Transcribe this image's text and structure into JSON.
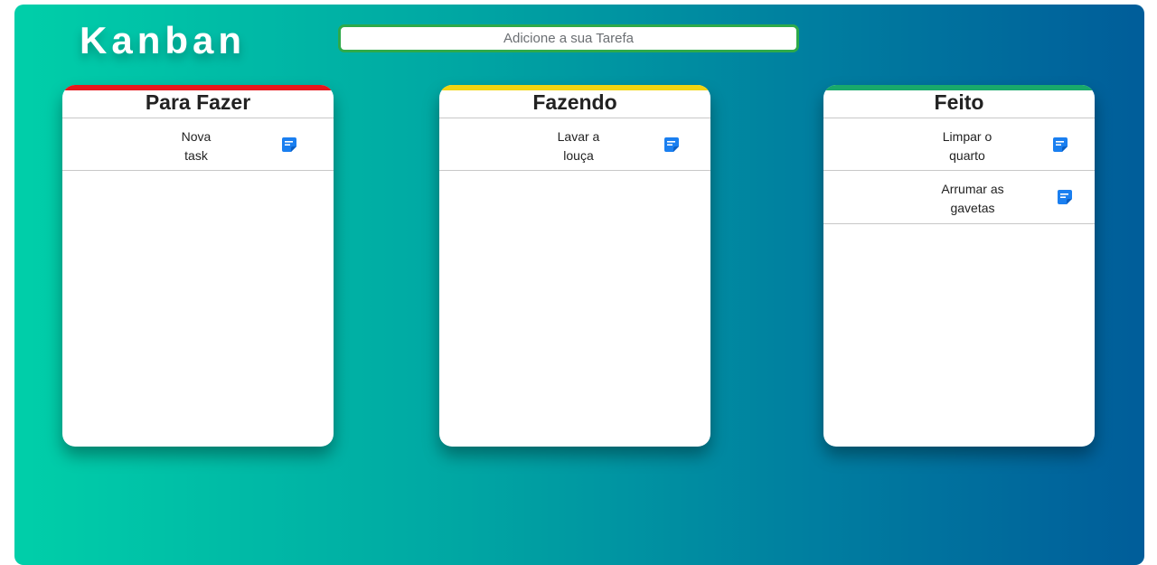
{
  "header": {
    "title": "Kanban"
  },
  "task_input": {
    "placeholder": "Adicione a sua Tarefa",
    "value": ""
  },
  "columns": [
    {
      "title": "Para Fazer",
      "accent": "#e8161b",
      "cards": [
        {
          "line1": "Nova",
          "line2": "task",
          "icon": "edit-note-icon"
        }
      ]
    },
    {
      "title": "Fazendo",
      "accent": "#f2d410",
      "cards": [
        {
          "line1": "Lavar a",
          "line2": "louça",
          "icon": "edit-note-icon"
        }
      ]
    },
    {
      "title": "Feito",
      "accent": "#19a96b",
      "cards": [
        {
          "line1": "Limpar o",
          "line2": "quarto",
          "icon": "edit-note-icon"
        },
        {
          "line1": "Arrumar as",
          "line2": "gavetas",
          "icon": "edit-note-icon"
        }
      ]
    }
  ],
  "colors": {
    "background_gradient_start": "#00cfa9",
    "background_gradient_end": "#005d9a",
    "input_border": "#2eaa4a",
    "icon": "#1a7ff0"
  }
}
